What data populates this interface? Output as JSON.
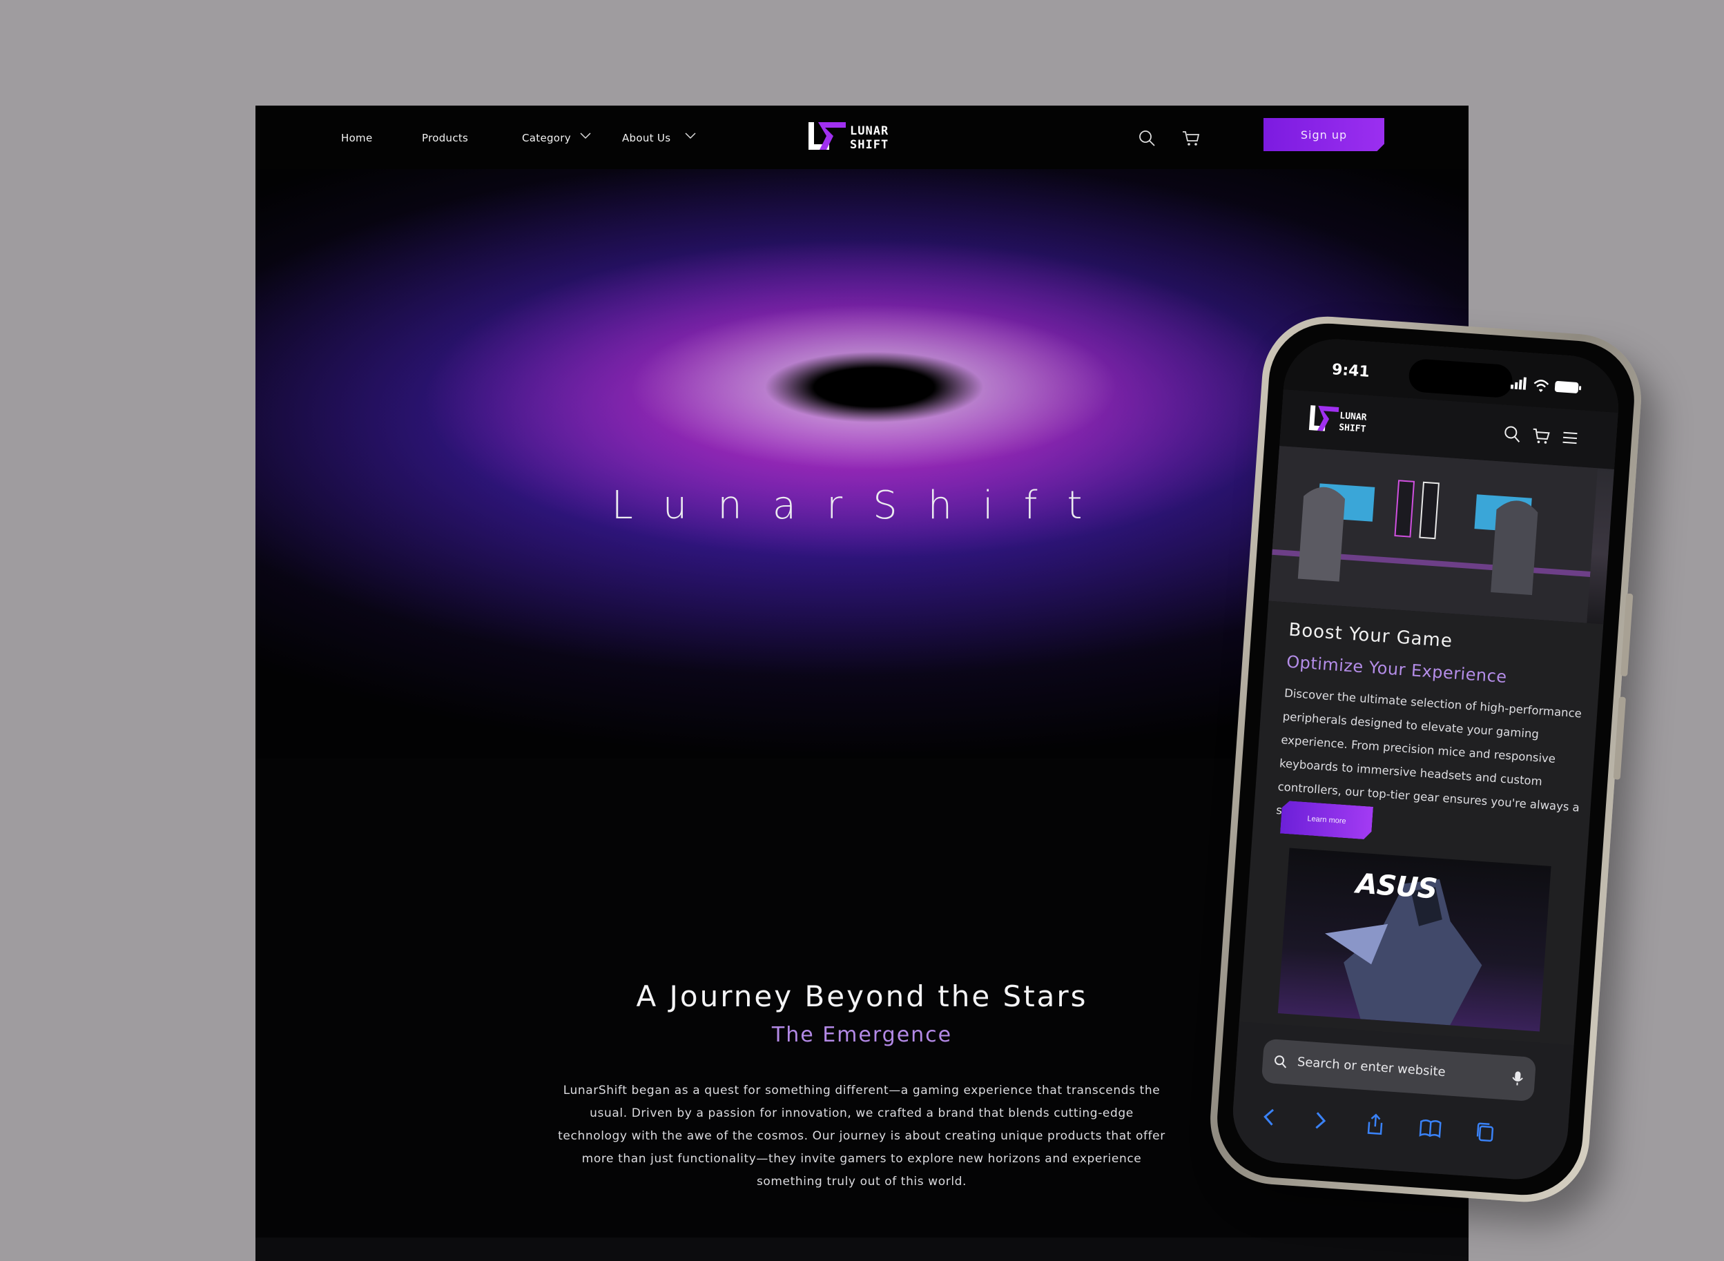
{
  "desktop": {
    "nav": {
      "home": "Home",
      "products": "Products",
      "category": "Category",
      "about": "About Us",
      "signup": "Sign up",
      "logo_text_line1": "LUNAR",
      "logo_text_line2": "SHIFT"
    },
    "hero": {
      "title": "LunarShift"
    },
    "story": {
      "title": "A Journey Beyond the Stars",
      "subtitle": "The Emergence",
      "body": "LunarShift began as a quest for something different—a gaming experience that transcends the usual. Driven by a passion for innovation, we crafted a brand that blends cutting-edge technology with the awe of the cosmos. Our journey is about creating unique products that offer more than just functionality—they invite gamers to explore new horizons and experience something truly out of this world."
    }
  },
  "phone": {
    "status": {
      "time": "9:41"
    },
    "section": {
      "heading": "Boost Your Game",
      "subheading": "Optimize Your Experience",
      "body": "Discover the ultimate selection of high-performance peripherals designed to elevate your gaming experience. From precision mice and responsive keyboards to immersive headsets and custom controllers, our top-tier gear ensures you're always a step ahead.",
      "learn_more": "Learn more"
    },
    "card": {
      "brand": "ASUS"
    },
    "browser": {
      "placeholder": "Search or enter website"
    }
  },
  "colors": {
    "accent": "#8a24e8",
    "subtitle_purple": "#b389e6",
    "page_bg": "#9f9c9f",
    "dark_bg": "#040405"
  }
}
